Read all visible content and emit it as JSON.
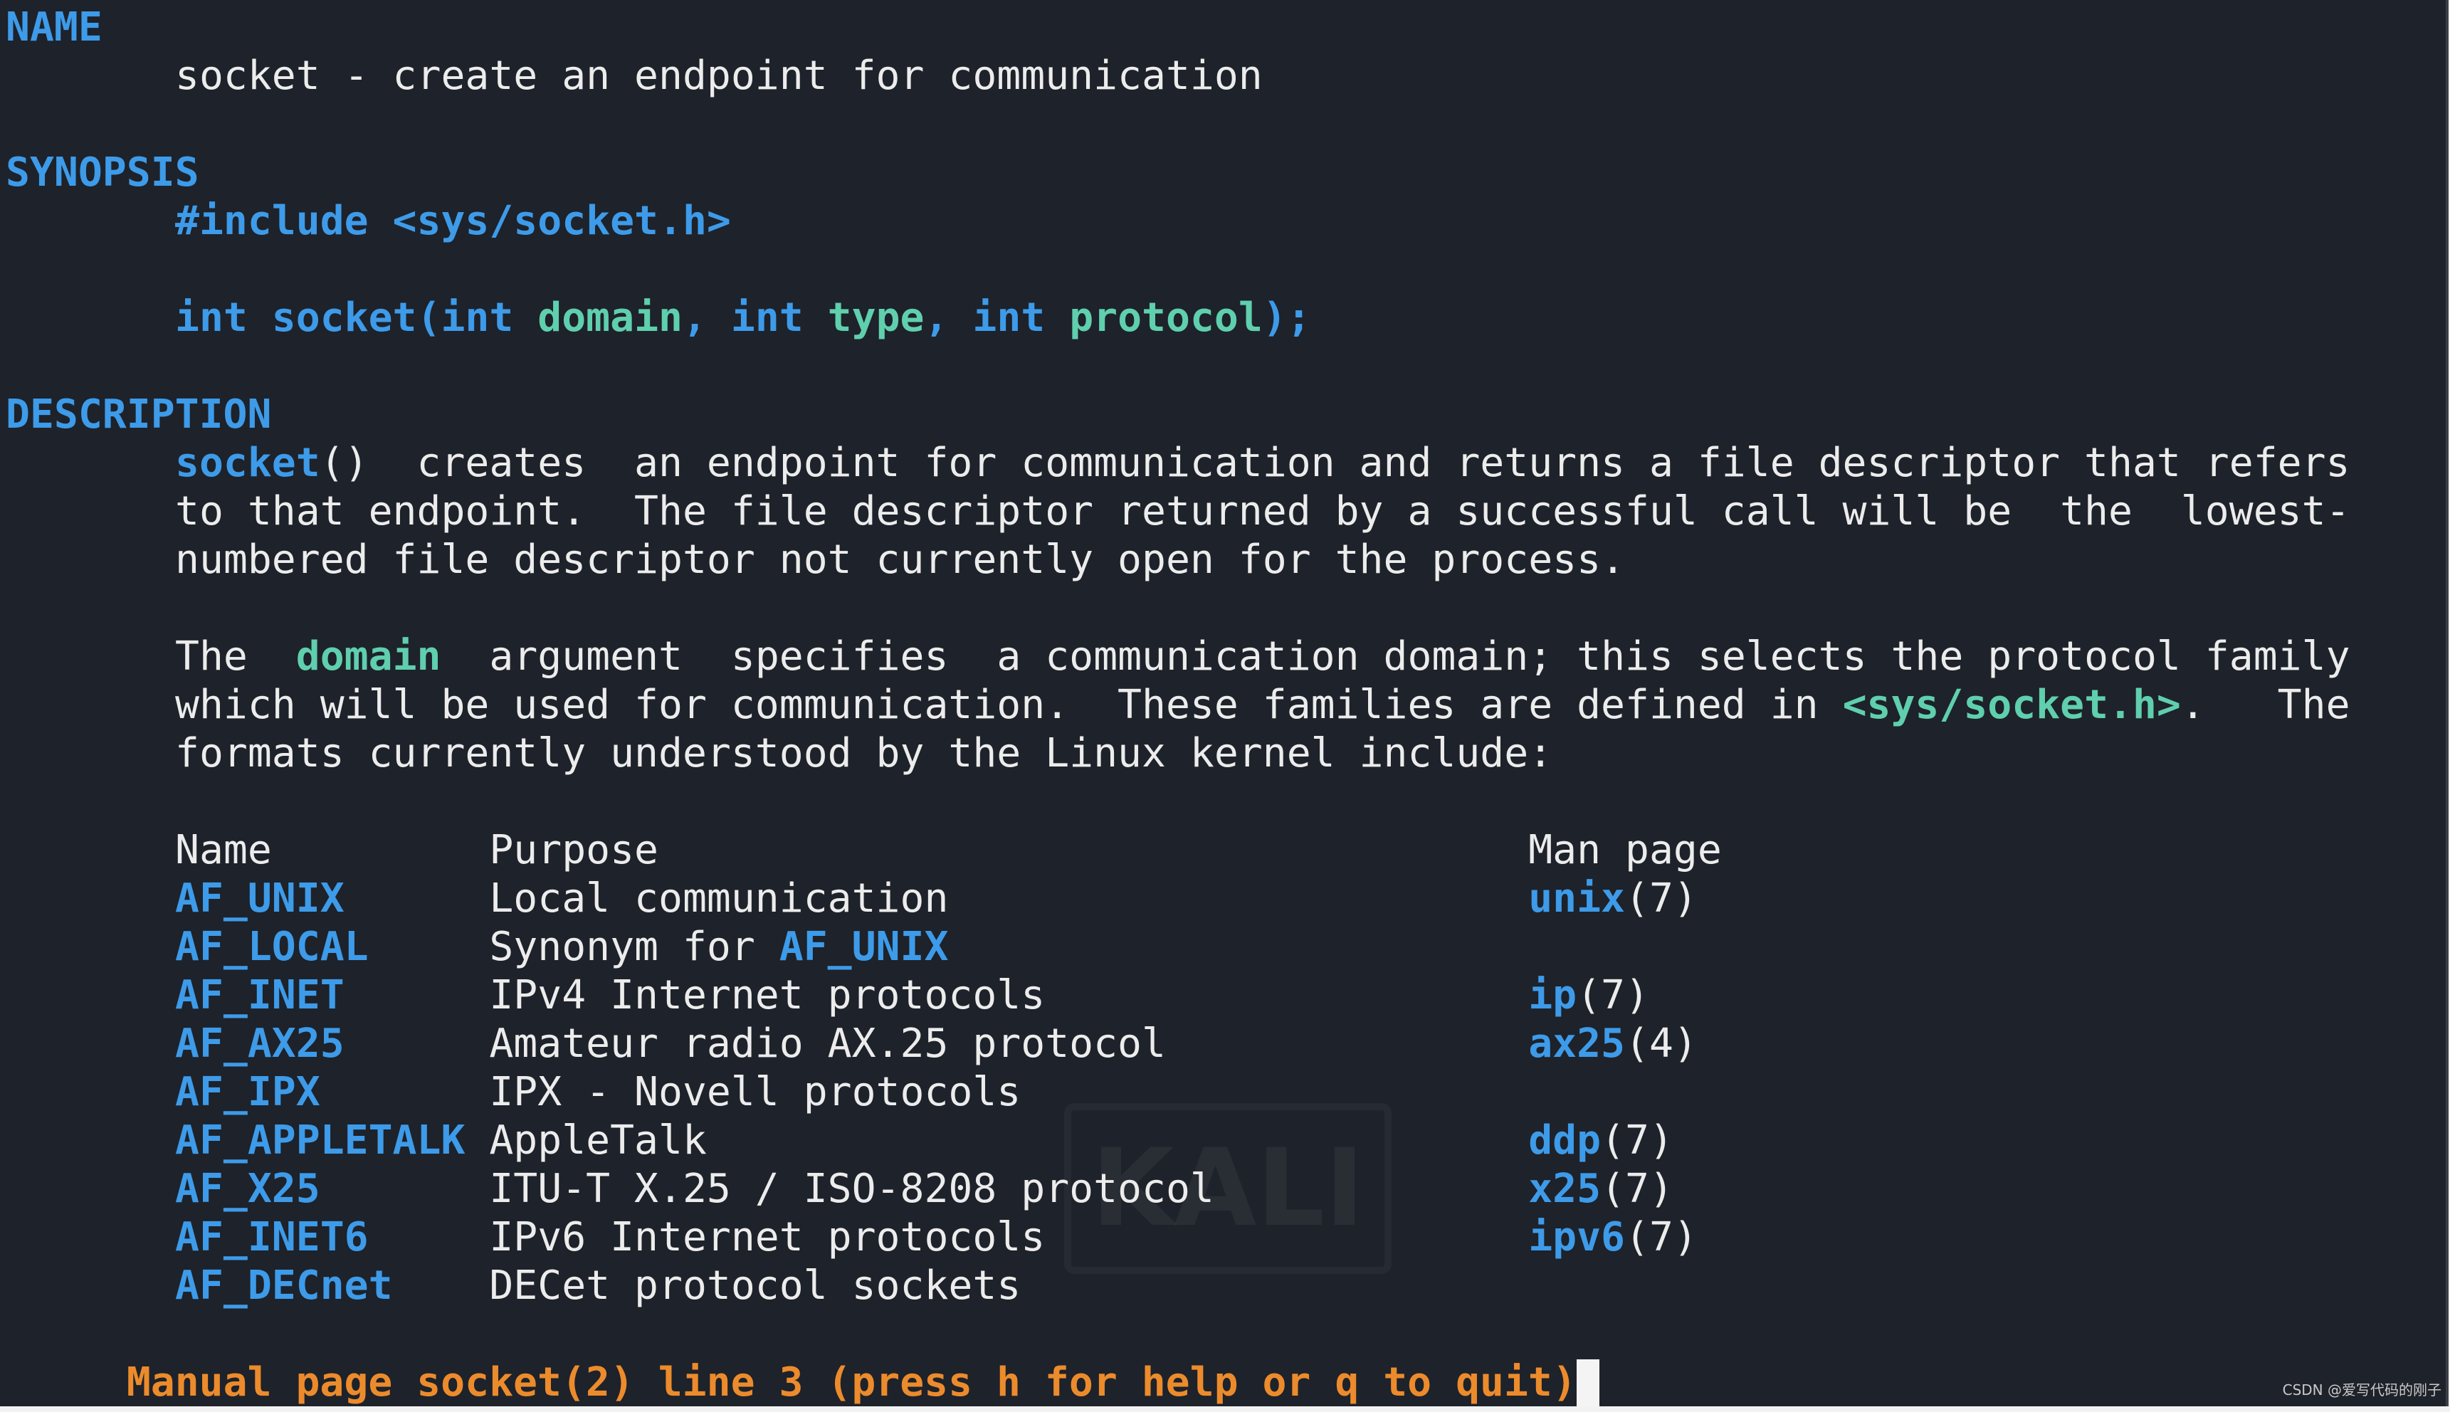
{
  "colors": {
    "background": "#1e222a",
    "heading": "#3d9be9",
    "bold": "#3d9be9",
    "argument": "#5fcfae",
    "text": "#ececec",
    "status": "#ec8b2c"
  },
  "lines": [
    {
      "kind": "hdr",
      "segs": [
        {
          "s": "h",
          "t": "NAME"
        }
      ]
    },
    {
      "kind": "ind",
      "segs": [
        {
          "s": "n",
          "t": "socket - create an endpoint for communication"
        }
      ]
    },
    null,
    {
      "kind": "hdr",
      "segs": [
        {
          "s": "h",
          "t": "SYNOPSIS"
        }
      ]
    },
    {
      "kind": "ind",
      "segs": [
        {
          "s": "b",
          "t": "#include <sys/socket.h>"
        }
      ]
    },
    null,
    {
      "kind": "ind",
      "segs": [
        {
          "s": "b",
          "t": "int socket(int "
        },
        {
          "s": "g",
          "t": "domain"
        },
        {
          "s": "b",
          "t": ", int "
        },
        {
          "s": "g",
          "t": "type"
        },
        {
          "s": "b",
          "t": ", int "
        },
        {
          "s": "g",
          "t": "protocol"
        },
        {
          "s": "b",
          "t": ");"
        }
      ]
    },
    null,
    {
      "kind": "hdr",
      "segs": [
        {
          "s": "h",
          "t": "DESCRIPTION"
        }
      ]
    },
    {
      "kind": "ind",
      "segs": [
        {
          "s": "b",
          "t": "socket"
        },
        {
          "s": "n",
          "t": "()  creates  an endpoint for communication and returns a file descriptor that refers"
        }
      ]
    },
    {
      "kind": "ind",
      "segs": [
        {
          "s": "n",
          "t": "to that endpoint.  The file descriptor returned by a successful call will be  the  lowest-"
        }
      ]
    },
    {
      "kind": "ind",
      "segs": [
        {
          "s": "n",
          "t": "numbered file descriptor not currently open for the process."
        }
      ]
    },
    null,
    {
      "kind": "ind",
      "segs": [
        {
          "s": "n",
          "t": "The  "
        },
        {
          "s": "g",
          "t": "domain"
        },
        {
          "s": "n",
          "t": "  argument  specifies  a communication domain; this selects the protocol family"
        }
      ]
    },
    {
      "kind": "ind",
      "segs": [
        {
          "s": "n",
          "t": "which will be used for communication.  These families are defined in "
        },
        {
          "s": "g",
          "t": "<sys/socket.h>"
        },
        {
          "s": "n",
          "t": ".   The"
        }
      ]
    },
    {
      "kind": "ind",
      "segs": [
        {
          "s": "n",
          "t": "formats currently understood by the Linux kernel include:"
        }
      ]
    },
    null
  ],
  "table": {
    "headers": [
      "Name",
      "Purpose",
      "Man page"
    ],
    "rows": [
      {
        "name": "AF_UNIX",
        "purpose": [
          {
            "s": "n",
            "t": "Local communication"
          }
        ],
        "man": "unix",
        "section": "(7)"
      },
      {
        "name": "AF_LOCAL",
        "purpose": [
          {
            "s": "n",
            "t": "Synonym for "
          },
          {
            "s": "b",
            "t": "AF_UNIX"
          }
        ],
        "man": "",
        "section": ""
      },
      {
        "name": "AF_INET",
        "purpose": [
          {
            "s": "n",
            "t": "IPv4 Internet protocols"
          }
        ],
        "man": "ip",
        "section": "(7)"
      },
      {
        "name": "AF_AX25",
        "purpose": [
          {
            "s": "n",
            "t": "Amateur radio AX.25 protocol"
          }
        ],
        "man": "ax25",
        "section": "(4)"
      },
      {
        "name": "AF_IPX",
        "purpose": [
          {
            "s": "n",
            "t": "IPX - Novell protocols"
          }
        ],
        "man": "",
        "section": ""
      },
      {
        "name": "AF_APPLETALK",
        "purpose": [
          {
            "s": "n",
            "t": "AppleTalk"
          }
        ],
        "man": "ddp",
        "section": "(7)"
      },
      {
        "name": "AF_X25",
        "purpose": [
          {
            "s": "n",
            "t": "ITU-T X.25 / ISO-8208 protocol"
          }
        ],
        "man": "x25",
        "section": "(7)"
      },
      {
        "name": "AF_INET6",
        "purpose": [
          {
            "s": "n",
            "t": "IPv6 Internet protocols"
          }
        ],
        "man": "ipv6",
        "section": "(7)"
      },
      {
        "name": "AF_DECnet",
        "purpose": [
          {
            "s": "n",
            "t": "DECet protocol sockets"
          }
        ],
        "man": "",
        "section": ""
      }
    ]
  },
  "status": {
    "text": "Manual page socket(2) line 3 (press h for help or q to quit)"
  },
  "watermarks": {
    "background_logo": "KALI",
    "credit": "CSDN @爱写代码的刚子"
  }
}
